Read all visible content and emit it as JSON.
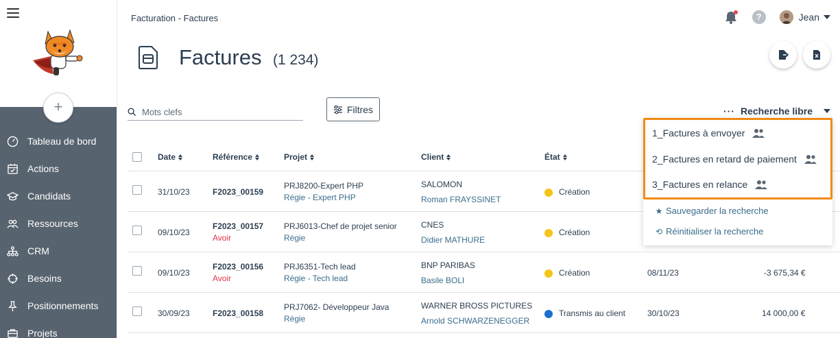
{
  "sidebar": {
    "plus_label": "+",
    "items": [
      {
        "label": "Tableau de bord",
        "icon": "gauge-icon"
      },
      {
        "label": "Actions",
        "icon": "calendar-check-icon"
      },
      {
        "label": "Candidats",
        "icon": "graduation-cap-icon"
      },
      {
        "label": "Ressources",
        "icon": "users-icon"
      },
      {
        "label": "CRM",
        "icon": "sitemap-icon"
      },
      {
        "label": "Besoins",
        "icon": "crosshair-icon"
      },
      {
        "label": "Positionnements",
        "icon": "pin-icon"
      },
      {
        "label": "Projets",
        "icon": "briefcase-icon"
      }
    ]
  },
  "header": {
    "breadcrumb": "Facturation - Factures",
    "user_name": "Jean",
    "help_label": "?"
  },
  "page": {
    "title": "Factures",
    "count": "(1 234)"
  },
  "toolbar": {
    "search_placeholder": "Mots clefs",
    "filters_label": "Filtres",
    "saved_search_dots": "···",
    "saved_search_label": "Recherche libre"
  },
  "table": {
    "columns": [
      "Date",
      "Référence",
      "Projet",
      "Client",
      "État"
    ],
    "rows": [
      {
        "date": "31/10/23",
        "reference": "F2023_00159",
        "ref_sub": "",
        "project": "PRJ8200-Expert PHP",
        "project_sub": "Régie  - Expert PHP",
        "client": "SALOMON",
        "client_contact": "Roman FRAYSSINET",
        "state": "Création",
        "state_color": "#f5c518",
        "due": "",
        "amount": ""
      },
      {
        "date": "09/10/23",
        "reference": "F2023_00157",
        "ref_sub": "Avoir",
        "project": "PRJ6013-Chef de projet senior",
        "project_sub": "Régie",
        "client": "CNES",
        "client_contact": "Didier MATHURE",
        "state": "Création",
        "state_color": "#f5c518",
        "due": "",
        "amount": ""
      },
      {
        "date": "09/10/23",
        "reference": "F2023_00156",
        "ref_sub": "Avoir",
        "project": "PRJ6351-Tech lead",
        "project_sub": "Régie  - Tech lead",
        "client": "BNP PARIBAS",
        "client_contact": "Basile BOLI",
        "state": "Création",
        "state_color": "#f5c518",
        "due": "08/11/23",
        "amount": "-3 675,34 €"
      },
      {
        "date": "30/09/23",
        "reference": "F2023_00158",
        "ref_sub": "",
        "project": "PRJ7062- Développeur Java",
        "project_sub": "Régie",
        "client": "WARNER BROSS PICTURES",
        "client_contact": "Arnold SCHWARZENEGGER",
        "state": "Transmis au client",
        "state_color": "#1a6fd1",
        "due": "30/10/23",
        "amount": "14 000,00 €"
      }
    ]
  },
  "dropdown": {
    "saved": [
      {
        "label": "1_Factures à envoyer"
      },
      {
        "label": "2_Factures en retard de paiement"
      },
      {
        "label": "3_Factures en relance"
      }
    ],
    "save_label": "Sauvegarder la recherche",
    "reset_label": "Réinitialiser la recherche"
  },
  "colors": {
    "sidebar_bg": "#57636f",
    "highlight": "#f18b15",
    "avoir": "#e0334b",
    "link": "#3a6d8c"
  }
}
